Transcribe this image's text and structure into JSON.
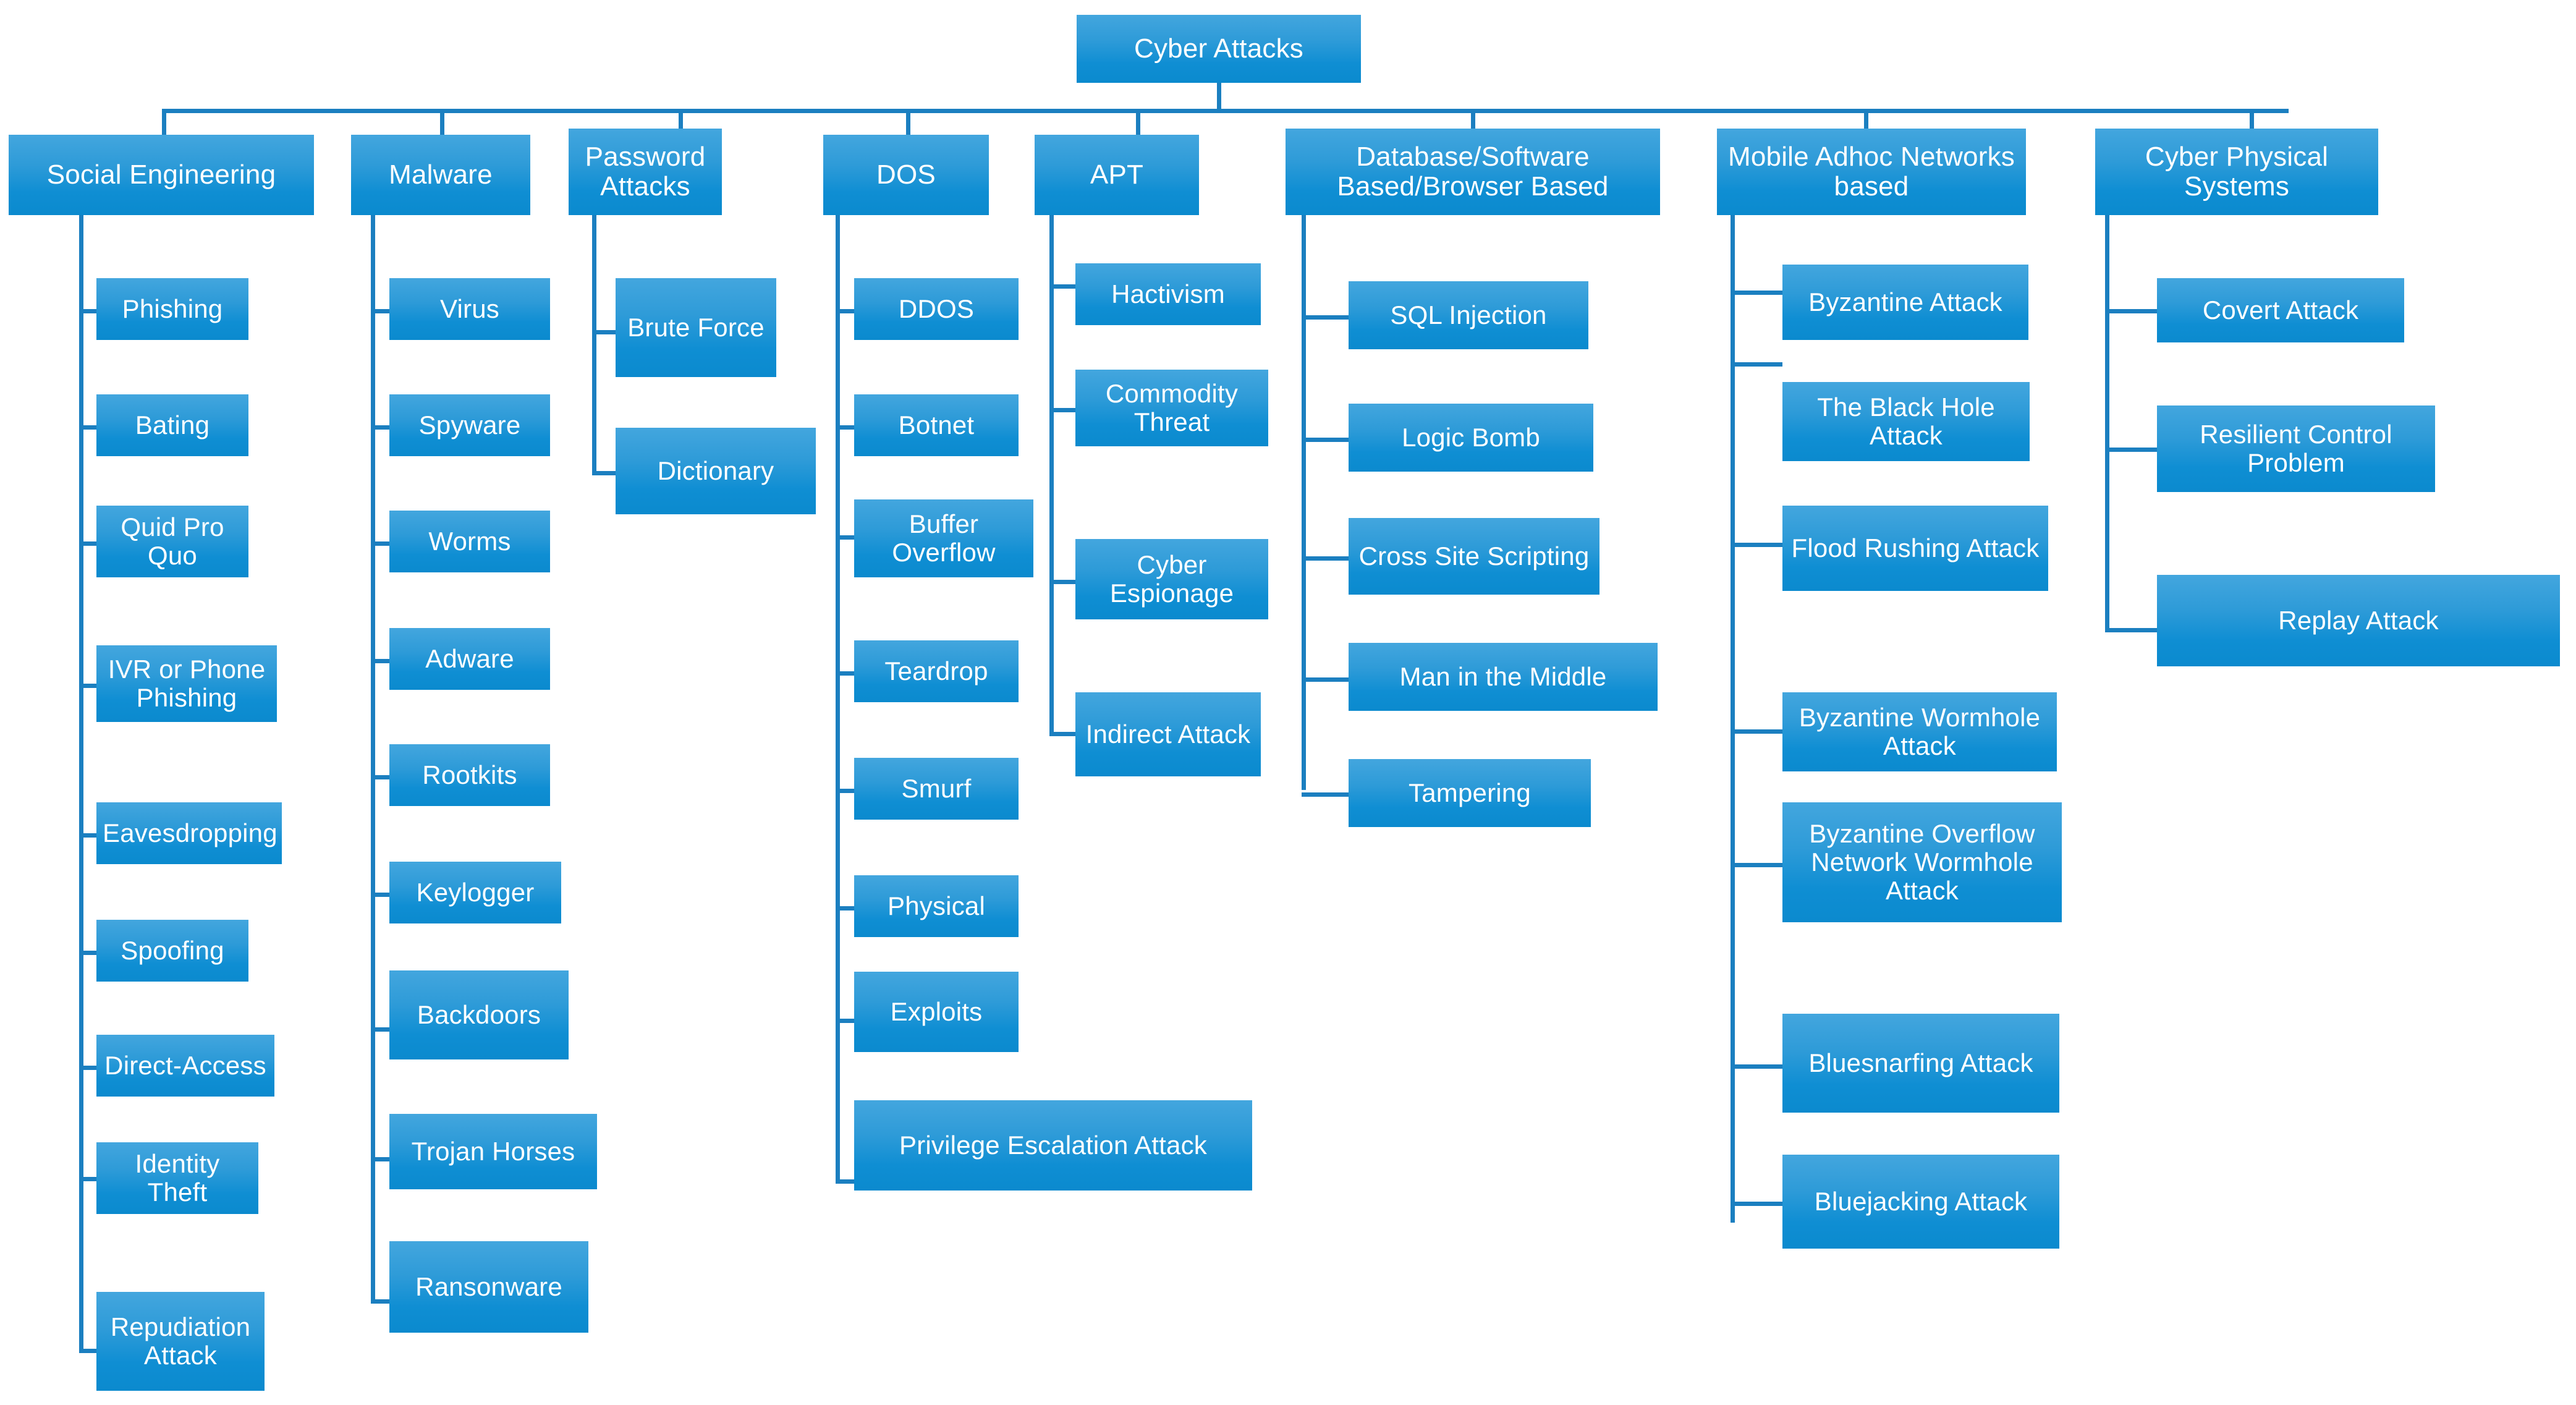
{
  "diagram": {
    "title": "Cyber Attacks",
    "type": "taxonomy-tree",
    "root_label": "Cyber Attacks",
    "colors": {
      "box_top": "#43a6de",
      "box_bottom": "#0b8ace",
      "connector": "#1b7fc0",
      "text": "#ffffff",
      "background": "#ffffff"
    },
    "categories": [
      {
        "id": "social-engineering",
        "label": "Social Engineering",
        "children": [
          "Phishing",
          "Bating",
          "Quid Pro Quo",
          "IVR or Phone Phishing",
          "Eavesdropping",
          "Spoofing",
          "Direct-Access",
          "Identity Theft",
          "Repudiation Attack"
        ]
      },
      {
        "id": "malware",
        "label": "Malware",
        "children": [
          "Virus",
          "Spyware",
          "Worms",
          "Adware",
          "Rootkits",
          "Keylogger",
          "Backdoors",
          "Trojan Horses",
          "Ransonware"
        ]
      },
      {
        "id": "password-attacks",
        "label": "Password Attacks",
        "children": [
          "Brute Force",
          "Dictionary"
        ]
      },
      {
        "id": "dos",
        "label": "DOS",
        "children": [
          "DDOS",
          "Botnet",
          "Buffer Overflow",
          "Teardrop",
          "Smurf",
          "Physical",
          "Exploits",
          "Privilege Escalation Attack"
        ]
      },
      {
        "id": "apt",
        "label": "APT",
        "children": [
          "Hactivism",
          "Commodity Threat",
          "Cyber Espionage",
          "Indirect Attack"
        ]
      },
      {
        "id": "database-software-browser",
        "label": "Database/Software Based/Browser Based",
        "children": [
          "SQL Injection",
          "Logic Bomb",
          "Cross Site Scripting",
          "Man in the Middle",
          "Tampering"
        ]
      },
      {
        "id": "mobile-adhoc-networks",
        "label": "Mobile Adhoc Networks based",
        "children": [
          "Byzantine Attack",
          "The Black Hole Attack",
          "Flood Rushing Attack",
          "Byzantine Wormhole Attack",
          "Byzantine Overflow Network Wormhole Attack",
          "Bluesnarfing Attack",
          "Bluejacking Attack"
        ]
      },
      {
        "id": "cyber-physical-systems",
        "label": "Cyber Physical Systems",
        "children": [
          "Covert Attack",
          "Resilient Control Problem",
          "Replay Attack"
        ]
      }
    ]
  }
}
